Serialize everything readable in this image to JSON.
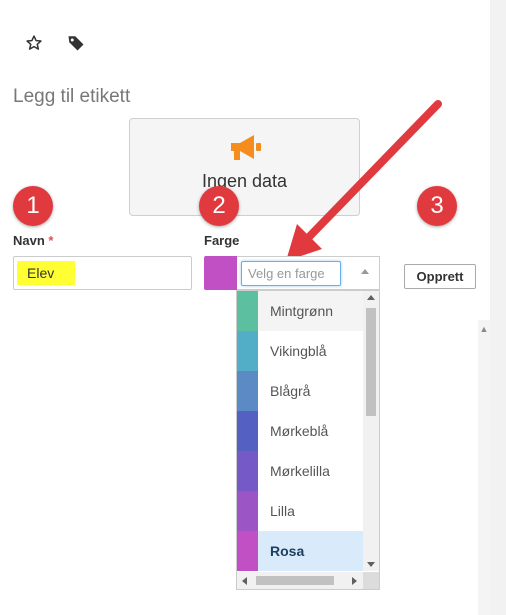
{
  "toolbar": {
    "star_icon": "star-outline-icon",
    "tag_icon": "tag-icon"
  },
  "heading": "Legg til etikett",
  "nodata": {
    "icon": "megaphone-icon",
    "icon_color": "#f58c1e",
    "text": "Ingen data"
  },
  "badges": [
    "1",
    "2",
    "3"
  ],
  "annotation_color": "#e03a3e",
  "form": {
    "name_label": "Navn",
    "required_mark": "*",
    "name_value": "Elev",
    "color_label": "Farge",
    "color_placeholder": "Velg en farge",
    "selected_color": "#c050c4",
    "create_button": "Opprett"
  },
  "dropdown": {
    "options": [
      {
        "label": "Mintgrønn",
        "color": "#5bbfa0"
      },
      {
        "label": "Vikingblå",
        "color": "#52aec6"
      },
      {
        "label": "Blågrå",
        "color": "#5b8ac4"
      },
      {
        "label": "Mørkeblå",
        "color": "#5460c2"
      },
      {
        "label": "Mørkelilla",
        "color": "#7559c6"
      },
      {
        "label": "Lilla",
        "color": "#9b55c4"
      },
      {
        "label": "Rosa",
        "color": "#c050c4"
      }
    ],
    "hover_index": 0,
    "selected_index": 6
  }
}
